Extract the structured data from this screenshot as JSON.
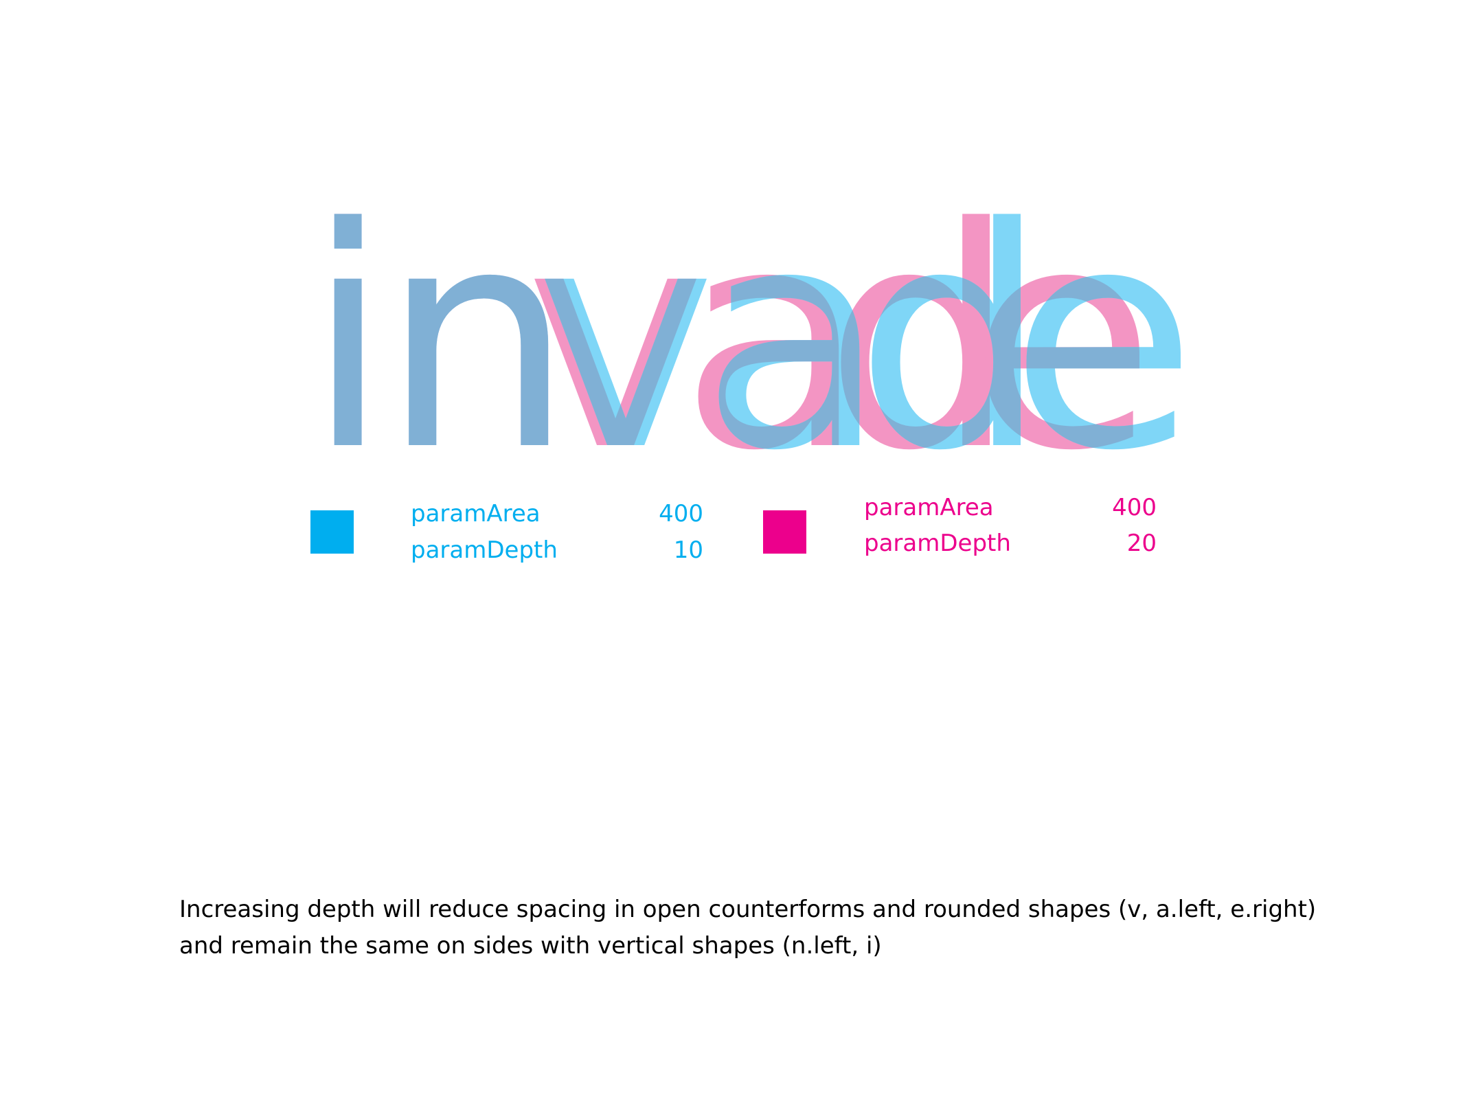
{
  "word": "invade",
  "colors": {
    "cyan": "#00aeef",
    "magenta": "#ec008c",
    "cyan_glyph": "#7fd6f7",
    "magenta_glyph": "#f395c3",
    "overlap_glyph": "#80b0d5",
    "caption_text": "#000000"
  },
  "legend": [
    {
      "swatch_color": "#00aeef",
      "params": [
        {
          "name": "paramArea",
          "value": "400"
        },
        {
          "name": "paramDepth",
          "value": "10"
        }
      ]
    },
    {
      "swatch_color": "#ec008c",
      "params": [
        {
          "name": "paramArea",
          "value": "400"
        },
        {
          "name": "paramDepth",
          "value": "20"
        }
      ]
    }
  ],
  "caption": {
    "line1": "Increasing depth will reduce spacing in open counterforms and rounded shapes (v, a.left, e.right)",
    "line2": "and remain the same on sides with vertical shapes (n.left, i)"
  }
}
